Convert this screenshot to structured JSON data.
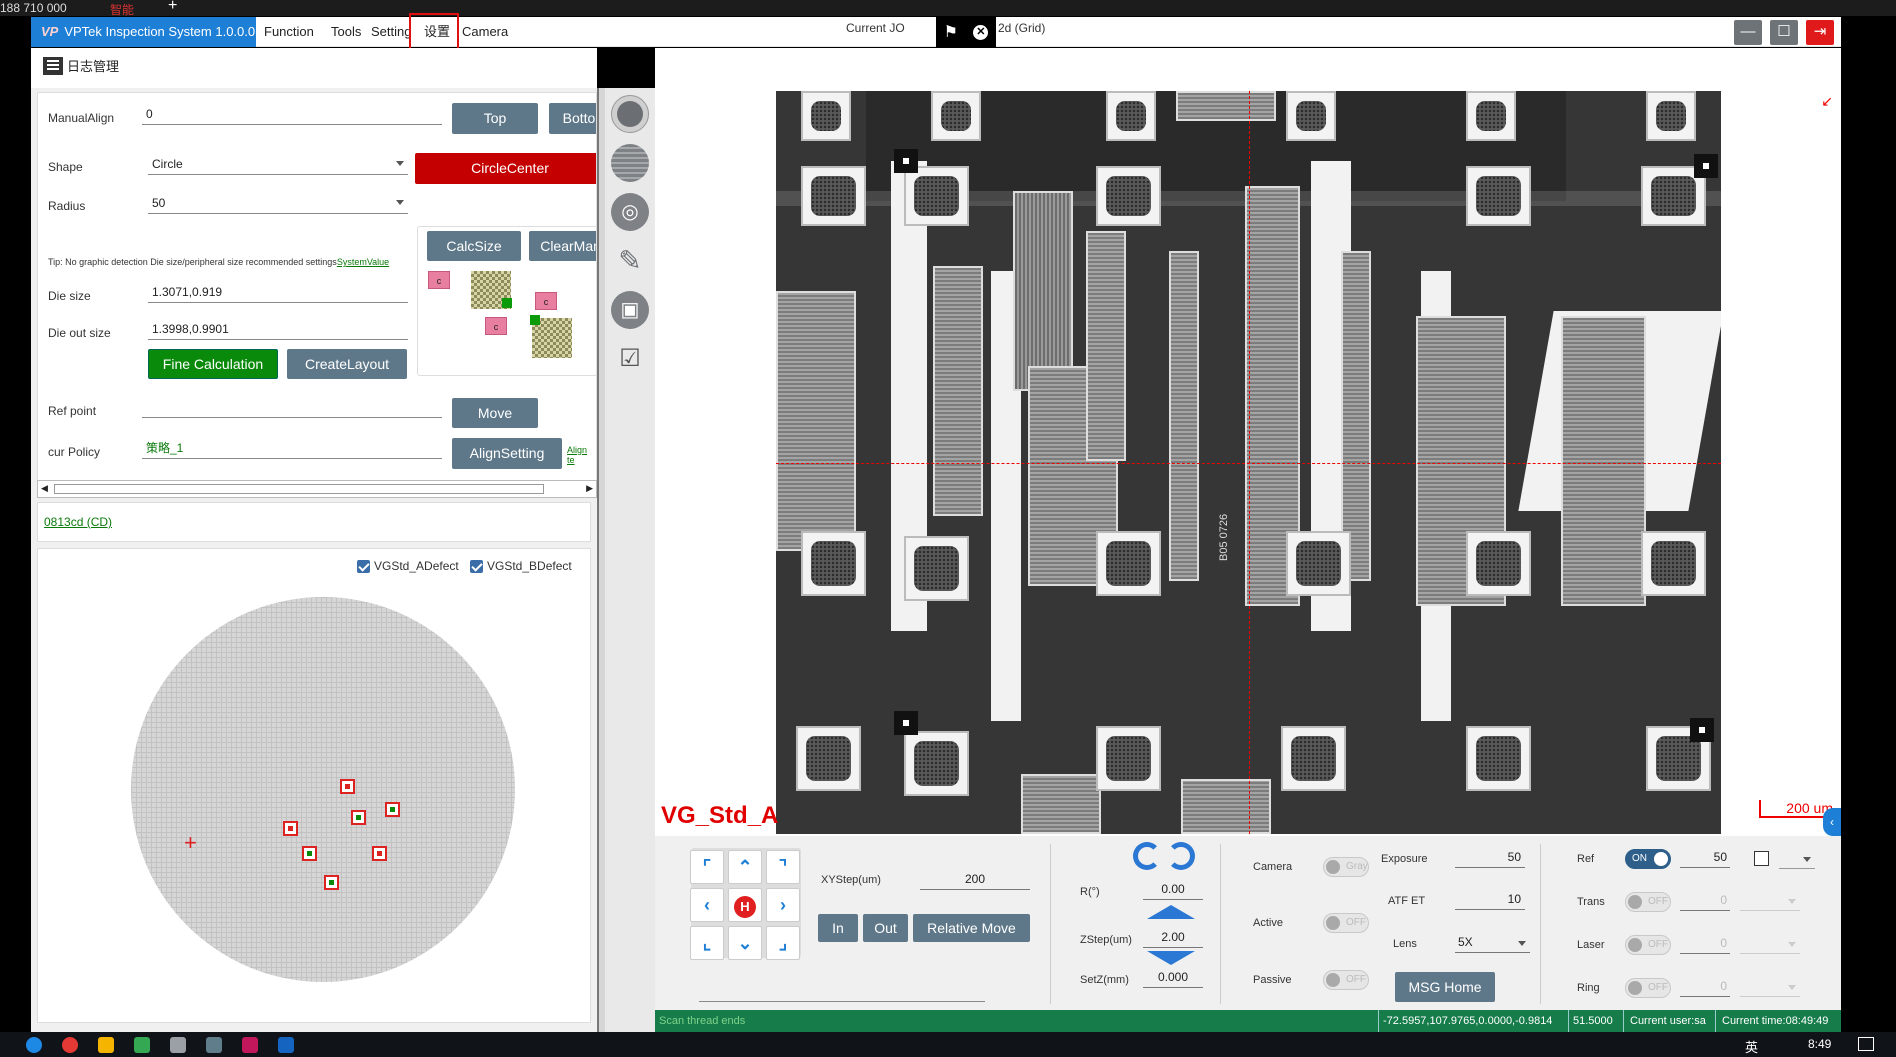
{
  "topstrip": {
    "left_text": "188 710 000",
    "mid_text": "智能"
  },
  "app": {
    "logo": "VP",
    "title": "VPTek Inspection System 1.0.0.0"
  },
  "menu": [
    "Function",
    "Tools",
    "Setting",
    "设置",
    "Camera"
  ],
  "job": {
    "label": "Current JO",
    "tail": "2d (Grid)"
  },
  "toolbar": {
    "log_button": "日志管理"
  },
  "form": {
    "manual_align_label": "ManualAlign",
    "manual_align_value": "0",
    "top_button": "Top",
    "bottom_button": "Botto",
    "shape_label": "Shape",
    "shape_value": "Circle",
    "circle_center_button": "CircleCenter",
    "radius_label": "Radius",
    "radius_value": "50",
    "calcsize_button": "CalcSize",
    "clearmark_button": "ClearMar",
    "tip_text": "Tip: No graphic detection Die size/peripheral size recommended settings",
    "tip_link": "SystemValue",
    "die_size_label": "Die size",
    "die_size_value": "1.3071,0.919",
    "die_out_label": "Die out size",
    "die_out_value": "1.3998,0.9901",
    "fine_calc_button": "Fine Calculation",
    "create_layout_button": "CreateLayout",
    "ref_point_label": "Ref point",
    "ref_point_value": "",
    "move_button": "Move",
    "policy_label": "cur Policy",
    "policy_value": "策略_1",
    "align_setting_button": "AlignSetting",
    "align_link": "Align te",
    "c_label": "c"
  },
  "job_link": "0813cd (CD)",
  "wafer": {
    "check1": "VGStd_ADefect",
    "check2": "VGStd_BDefect"
  },
  "viewer": {
    "recipe_label": "VG_Std_A",
    "scale_text": "200 um",
    "chip_text": "B05 0726"
  },
  "motion": {
    "xystep_label": "XYStep(um)",
    "xystep_value": "200",
    "in_button": "In",
    "out_button": "Out",
    "relmove_button": "Relative Move",
    "home_label": "H",
    "r_label": "R(°)",
    "r_value": "0.00",
    "zstep_label": "ZStep(um)",
    "zstep_value": "2.00",
    "setz_label": "SetZ(mm)",
    "setz_value": "0.000"
  },
  "camera": {
    "camera_label": "Camera",
    "camera_toggle": "Gray",
    "active_label": "Active",
    "active_toggle": "OFF",
    "passive_label": "Passive",
    "passive_toggle": "OFF",
    "exposure_label": "Exposure",
    "exposure_value": "50",
    "atf_label": "ATF ET",
    "atf_value": "10",
    "lens_label": "Lens",
    "lens_value": "5X",
    "msg_home_button": "MSG Home"
  },
  "light": {
    "ref_label": "Ref",
    "ref_toggle": "ON",
    "ref_value": "50",
    "trans_label": "Trans",
    "trans_toggle": "OFF",
    "trans_value": "0",
    "laser_label": "Laser",
    "laser_toggle": "OFF",
    "laser_value": "0",
    "ring_label": "Ring",
    "ring_toggle": "OFF",
    "ring_value": "0"
  },
  "status": {
    "message": "Scan thread ends",
    "coords": "-72.5957,107.9765,0.0000,-0.9814",
    "zvalue": "51.5000",
    "user": "Current user:sa",
    "time": "Current time:08:49:49"
  },
  "taskbar": {
    "ime": "英",
    "clock": "8:49"
  }
}
